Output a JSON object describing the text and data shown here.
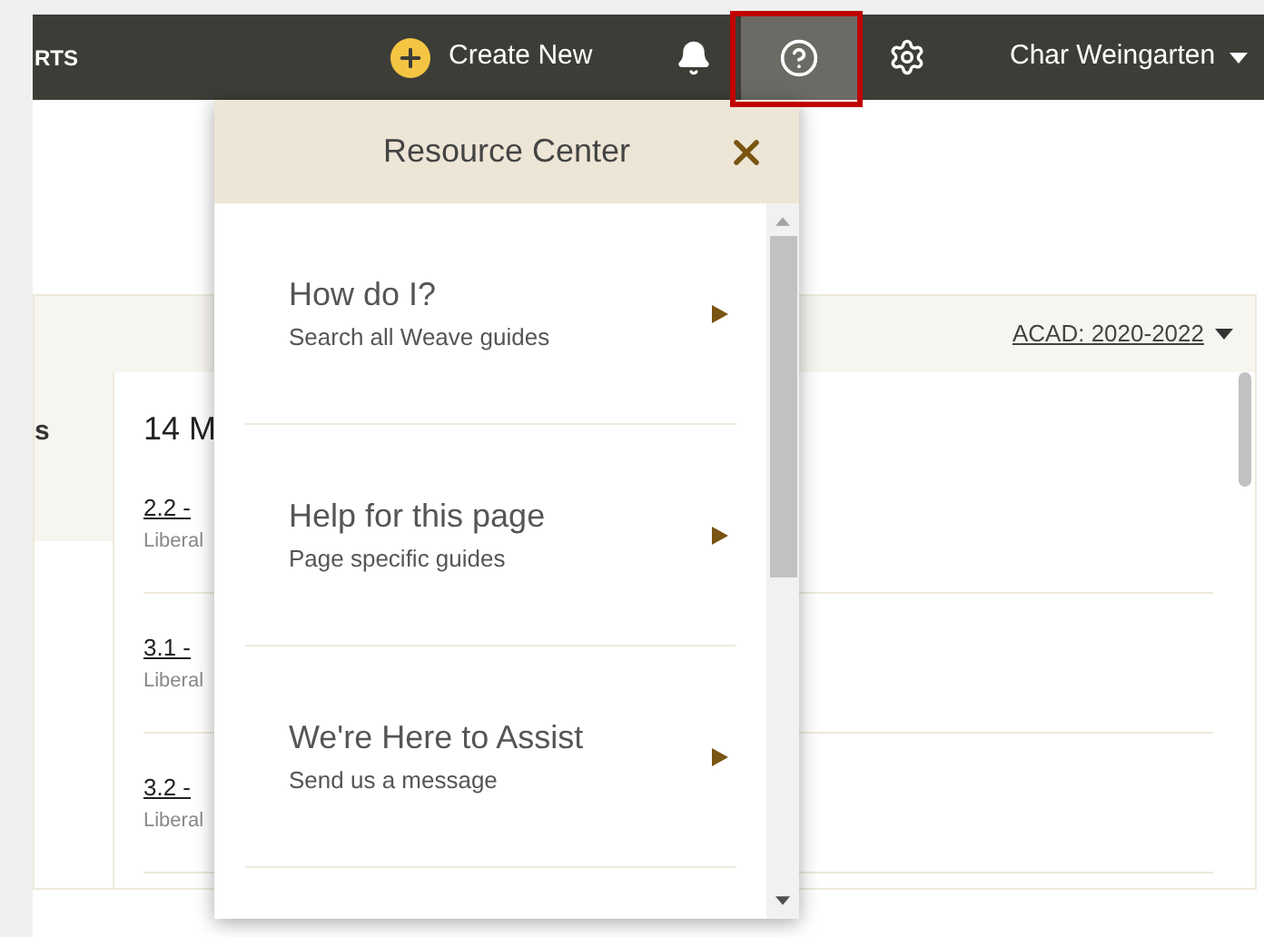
{
  "topbar": {
    "brand_fragment": "RTS",
    "create_button": "Create New",
    "help_button": {
      "active": true,
      "highlighted": true
    },
    "user_name": "Char Weingarten"
  },
  "content": {
    "year_selector": "ACAD: 2020-2022",
    "left_column_label": "s",
    "heading": "14 M",
    "items": [
      {
        "code": "2.2 -",
        "subtitle": "Liberal"
      },
      {
        "code": "3.1 -",
        "subtitle": "Liberal"
      },
      {
        "code": "3.2 -",
        "subtitle": "Liberal"
      }
    ]
  },
  "resource_center": {
    "title": "Resource Center",
    "items": [
      {
        "title": "How do I?",
        "subtitle": "Search all Weave guides"
      },
      {
        "title": "Help for this page",
        "subtitle": "Page specific guides"
      },
      {
        "title": "We're Here to Assist",
        "subtitle": "Send us a message"
      }
    ]
  }
}
